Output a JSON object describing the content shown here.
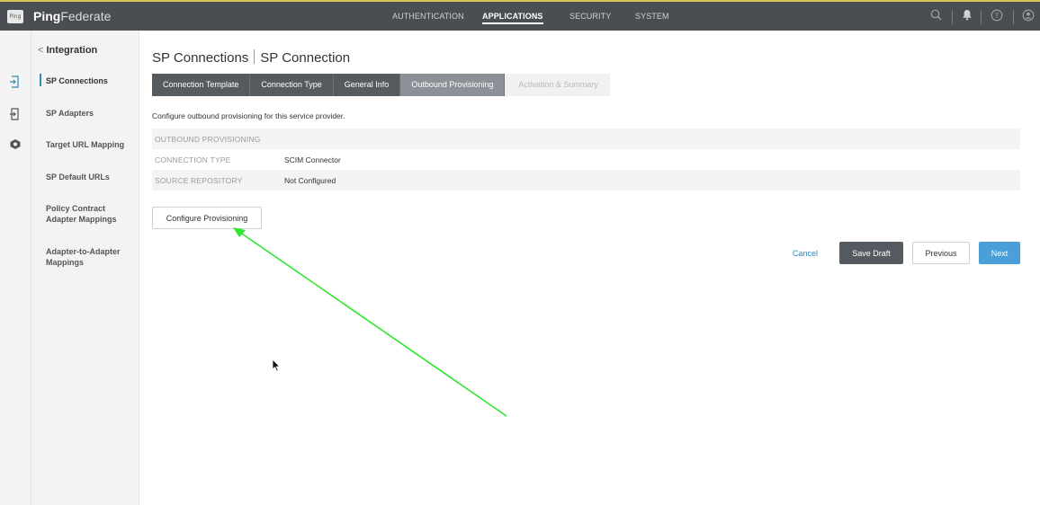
{
  "topbar": {
    "logo_text": "Ping",
    "brand_bold": "Ping",
    "brand_light": "Federate",
    "nav": [
      {
        "label": "AUTHENTICATION",
        "active": false
      },
      {
        "label": "APPLICATIONS",
        "active": true
      },
      {
        "label": "SECURITY",
        "active": false
      },
      {
        "label": "SYSTEM",
        "active": false
      }
    ],
    "icons": [
      "search-icon",
      "bell-icon",
      "help-icon",
      "user-icon"
    ]
  },
  "rail": {
    "icons": [
      "sp-connections-icon",
      "sp-adapters-icon",
      "target-url-icon"
    ]
  },
  "sidebar": {
    "back_label": "Integration",
    "back_chevron": "<",
    "items": [
      {
        "label": "SP Connections",
        "active": true
      },
      {
        "label": "SP Adapters",
        "active": false
      },
      {
        "label": "Target URL Mapping",
        "active": false
      },
      {
        "label": "SP Default URLs",
        "active": false
      },
      {
        "label": "Policy Contract Adapter Mappings",
        "active": false
      },
      {
        "label": "Adapter-to-Adapter Mappings",
        "active": false
      }
    ]
  },
  "main": {
    "title_left": "SP Connections",
    "title_right": "SP Connection",
    "tabs": [
      {
        "label": "Connection Template",
        "state": "done"
      },
      {
        "label": "Connection Type",
        "state": "done"
      },
      {
        "label": "General Info",
        "state": "done"
      },
      {
        "label": "Outbound Provisioning",
        "state": "current"
      },
      {
        "label": "Activation & Summary",
        "state": "disabled"
      }
    ],
    "description": "Configure outbound provisioning for this service provider.",
    "table": [
      {
        "key": "OUTBOUND PROVISIONING",
        "value": ""
      },
      {
        "key": "CONNECTION TYPE",
        "value": "SCIM Connector"
      },
      {
        "key": "SOURCE REPOSITORY",
        "value": "Not Configured"
      }
    ],
    "configure_button": "Configure Provisioning"
  },
  "footer_buttons": {
    "cancel": "Cancel",
    "save_draft": "Save Draft",
    "previous": "Previous",
    "next": "Next"
  },
  "colors": {
    "topbar": "#4a4e52",
    "accent": "#2b8ab8",
    "next_button": "#4a9fd8",
    "tab_dark": "#565b60",
    "tab_current": "#8b9196",
    "annotation_arrow": "#2ee62e"
  }
}
